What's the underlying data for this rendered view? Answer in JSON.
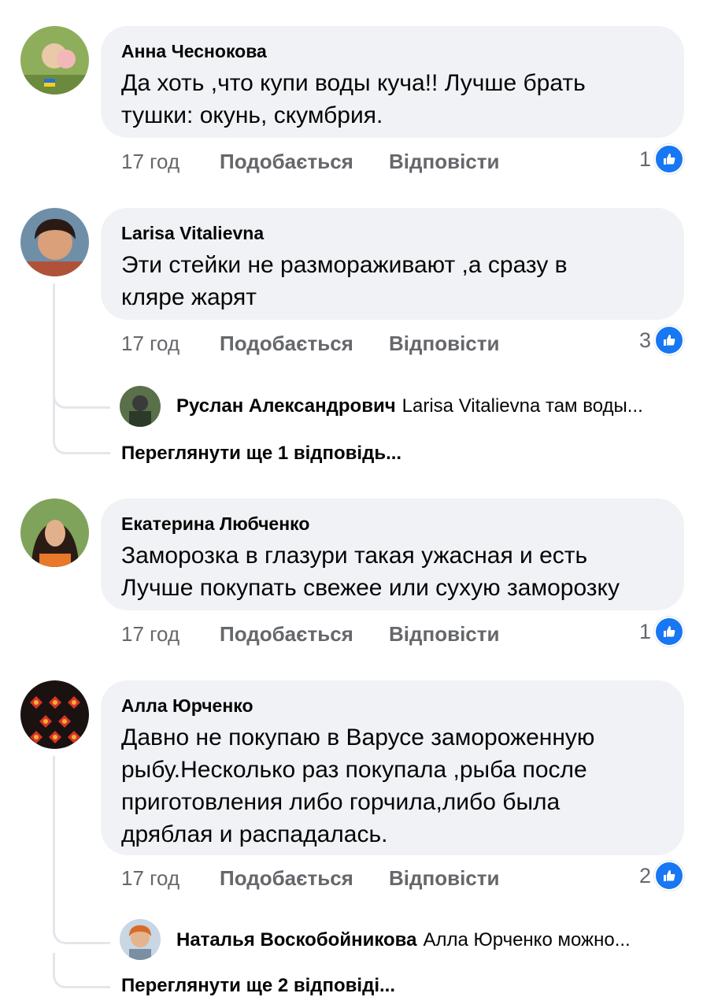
{
  "comments": [
    {
      "author": "Анна Чеснокова",
      "lines": [
        "Да хоть ,что купи воды куча!! Лучше брать",
        "тушки: окунь, скумбрия."
      ],
      "time": "17 год",
      "like_label": "Подобається",
      "reply_label": "Відповісти",
      "reactions": "1"
    },
    {
      "author": "Larisa Vitalievna",
      "lines": [
        "Эти стейки не размораживают ,а сразу в",
        "кляре жарят"
      ],
      "time": "17 год",
      "like_label": "Подобається",
      "reply_label": "Відповісти",
      "reactions": "3",
      "reply_preview": {
        "author": "Руслан Александрович",
        "text": "Larisa Vitalievna там воды..."
      },
      "more_replies": "Переглянути ще 1 відповідь..."
    },
    {
      "author": "Екатерина Любченко",
      "lines": [
        "Заморозка в глазури такая ужасная и есть",
        "Лучше покупать свежее или сухую заморозку"
      ],
      "time": "17 год",
      "like_label": "Подобається",
      "reply_label": "Відповісти",
      "reactions": "1"
    },
    {
      "author": "Алла Юрченко",
      "lines": [
        "Давно не покупаю в Варусе замороженную",
        "рыбу.Несколько раз покупала ,рыба после",
        "приготовления либо горчила,либо была",
        "дряблая и распадалась."
      ],
      "time": "17 год",
      "like_label": "Подобається",
      "reply_label": "Відповісти",
      "reactions": "2",
      "reply_preview": {
        "author": "Наталья Воскобойникова",
        "text": "Алла Юрченко можно..."
      },
      "more_replies": "Переглянути ще 2 відповіді..."
    }
  ],
  "icons": {
    "reaction": "like-thumb-icon"
  },
  "colors": {
    "bubble": "#f0f2f5",
    "meta": "#65676b",
    "like_blue": "#1877f2"
  }
}
